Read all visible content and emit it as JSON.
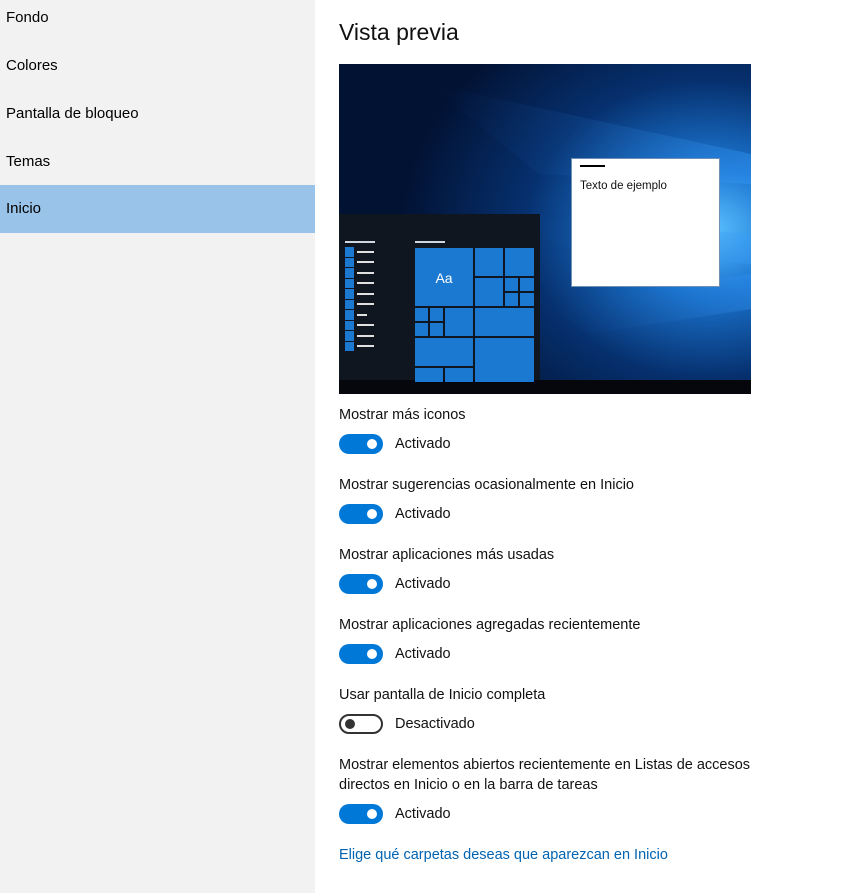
{
  "sidebar": {
    "items": [
      {
        "label": "Fondo"
      },
      {
        "label": "Colores"
      },
      {
        "label": "Pantalla de bloqueo"
      },
      {
        "label": "Temas"
      },
      {
        "label": "Inicio"
      }
    ],
    "selected_index": 4
  },
  "main": {
    "title": "Vista previa",
    "preview": {
      "tile_label": "Aa",
      "sample_text": "Texto de ejemplo"
    },
    "settings": [
      {
        "label": "Mostrar más iconos",
        "state": "Activado",
        "on": true
      },
      {
        "label": "Mostrar sugerencias ocasionalmente en Inicio",
        "state": "Activado",
        "on": true
      },
      {
        "label": "Mostrar aplicaciones más usadas",
        "state": "Activado",
        "on": true
      },
      {
        "label": "Mostrar aplicaciones agregadas recientemente",
        "state": "Activado",
        "on": true
      },
      {
        "label": "Usar pantalla de Inicio completa",
        "state": "Desactivado",
        "on": false
      },
      {
        "label": "Mostrar elementos abiertos recientemente en Listas de accesos directos en Inicio o en la barra de tareas",
        "state": "Activado",
        "on": true
      }
    ],
    "link": "Elige qué carpetas deseas que aparezcan en Inicio"
  },
  "colors": {
    "accent": "#0078d7",
    "sidebar_bg": "#f2f2f2",
    "selected_bg": "#99c3e8",
    "link": "#0063b1"
  }
}
